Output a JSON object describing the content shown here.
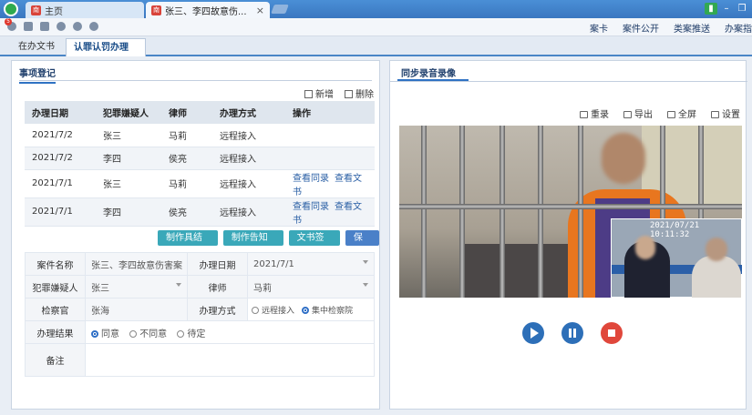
{
  "browser": {
    "home_tab": "主页",
    "active_tab": "张三、李四故意伤...",
    "tab_icon_char": "南"
  },
  "toolbar": {
    "badge_count": "5",
    "nav": [
      "案卡",
      "案件公开",
      "类案推送",
      "办案指"
    ]
  },
  "page_tabs": {
    "inactive": "在办文书",
    "active": "认罪认罚办理"
  },
  "left": {
    "section_title": "事项登记",
    "add_label": "新增",
    "delete_label": "删除",
    "columns": [
      "办理日期",
      "犯罪嫌疑人",
      "律师",
      "办理方式",
      "操作"
    ],
    "rows": [
      {
        "date": "2021/7/2",
        "suspect": "张三",
        "lawyer": "马莉",
        "method": "远程接入",
        "op1": "",
        "op2": ""
      },
      {
        "date": "2021/7/2",
        "suspect": "李四",
        "lawyer": "侯亮",
        "method": "远程接入",
        "op1": "",
        "op2": ""
      },
      {
        "date": "2021/7/1",
        "suspect": "张三",
        "lawyer": "马莉",
        "method": "远程接入",
        "op1": "查看同录",
        "op2": "查看文书"
      },
      {
        "date": "2021/7/1",
        "suspect": "李四",
        "lawyer": "侯亮",
        "method": "远程接入",
        "op1": "查看同录",
        "op2": "查看文书"
      }
    ],
    "buttons": [
      "制作具结书",
      "制作告知书",
      "文书签名",
      "保存"
    ],
    "form": {
      "case_name_label": "案件名称",
      "case_name": "张三、李四故意伤害案",
      "date_label": "办理日期",
      "date": "2021/7/1",
      "suspect_label": "犯罪嫌疑人",
      "suspect": "张三",
      "lawyer_label": "律师",
      "lawyer": "马莉",
      "prosecutor_label": "检察官",
      "prosecutor": "张海",
      "method_label": "办理方式",
      "method_opt1": "远程接入",
      "method_opt2": "集中检察院",
      "result_label": "办理结果",
      "result_opt1": "同意",
      "result_opt2": "不同意",
      "result_opt3": "待定",
      "remark_label": "备注"
    }
  },
  "right": {
    "title": "同步录音录像",
    "tools": [
      "重录",
      "导出",
      "全屏",
      "设置"
    ],
    "pip_timestamp": "2021/07/21 10:11:32"
  }
}
